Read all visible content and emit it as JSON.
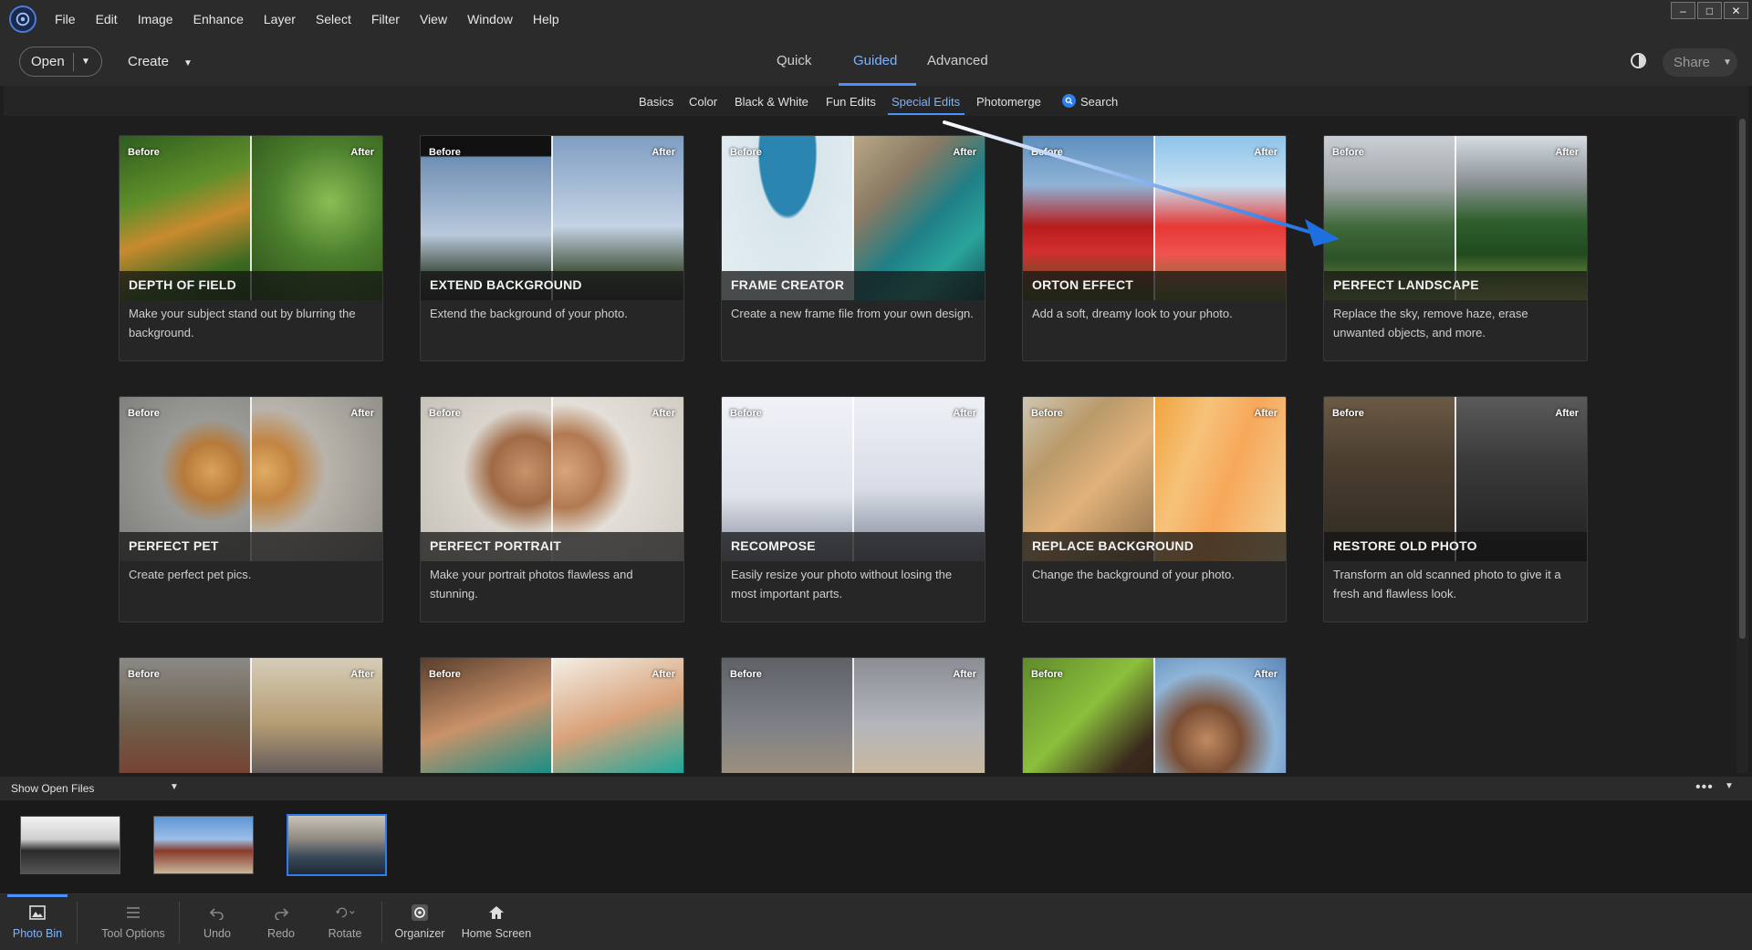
{
  "menu": {
    "items": [
      "File",
      "Edit",
      "Image",
      "Enhance",
      "Layer",
      "Select",
      "Filter",
      "View",
      "Window",
      "Help"
    ]
  },
  "window_controls": {
    "minimize": "–",
    "maximize": "□",
    "close": "✕"
  },
  "toolbar": {
    "open_label": "Open",
    "create_label": "Create",
    "modes": [
      "Quick",
      "Guided",
      "Advanced"
    ],
    "active_mode": "Guided",
    "share_label": "Share"
  },
  "categories": {
    "items": [
      "Basics",
      "Color",
      "Black & White",
      "Fun Edits",
      "Special Edits",
      "Photomerge"
    ],
    "active": "Special Edits",
    "search_label": "Search"
  },
  "card_tags": {
    "before": "Before",
    "after": "After"
  },
  "cards": [
    {
      "title": "DEPTH OF FIELD",
      "desc": "Make your subject stand out by blurring the background."
    },
    {
      "title": "EXTEND BACKGROUND",
      "desc": "Extend the background of your photo."
    },
    {
      "title": "FRAME CREATOR",
      "desc": "Create a new frame file from your own design."
    },
    {
      "title": "ORTON EFFECT",
      "desc": "Add a soft, dreamy look to your photo."
    },
    {
      "title": "PERFECT LANDSCAPE",
      "desc": "Replace the sky, remove haze, erase unwanted objects, and more."
    },
    {
      "title": "PERFECT PET",
      "desc": "Create perfect pet pics."
    },
    {
      "title": "PERFECT PORTRAIT",
      "desc": "Make your portrait photos flawless and stunning."
    },
    {
      "title": "RECOMPOSE",
      "desc": "Easily resize your photo without losing the most important parts."
    },
    {
      "title": "REPLACE BACKGROUND",
      "desc": "Change the background of your photo."
    },
    {
      "title": "RESTORE OLD PHOTO",
      "desc": "Transform an old scanned photo to give it a fresh and flawless look."
    },
    {
      "title": "",
      "desc": ""
    },
    {
      "title": "",
      "desc": ""
    },
    {
      "title": "",
      "desc": ""
    },
    {
      "title": "",
      "desc": ""
    }
  ],
  "photo_bin": {
    "show_label": "Show Open Files",
    "more_label": "•••"
  },
  "taskbar": {
    "items": [
      "Photo Bin",
      "Tool Options",
      "Undo",
      "Redo",
      "Rotate",
      "Organizer",
      "Home Screen"
    ]
  },
  "colors": {
    "accent": "#4a90ff",
    "accent_text": "#7eb3ff",
    "bg": "#1e1e1e",
    "panel": "#2b2b2b"
  }
}
